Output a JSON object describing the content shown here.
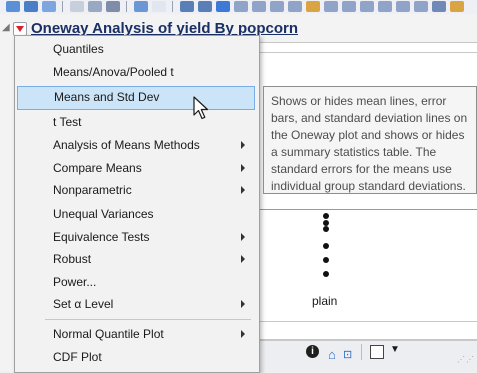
{
  "report": {
    "title": "Oneway Analysis of yield By popcorn",
    "category_label": "plain"
  },
  "menu": {
    "items": [
      {
        "label": "Quantiles",
        "submenu": false
      },
      {
        "label": "Means/Anova/Pooled t",
        "submenu": false
      },
      {
        "label": "Means and Std Dev",
        "submenu": false,
        "highlighted": true
      },
      {
        "label": "t Test",
        "submenu": false
      },
      {
        "label": "Analysis of Means Methods",
        "submenu": true
      },
      {
        "label": "Compare Means",
        "submenu": true
      },
      {
        "label": "Nonparametric",
        "submenu": true
      },
      {
        "label": "Unequal Variances",
        "submenu": false
      },
      {
        "label": "Equivalence Tests",
        "submenu": true
      },
      {
        "label": "Robust",
        "submenu": true
      },
      {
        "label": "Power...",
        "submenu": false
      },
      {
        "label": "Set α Level",
        "submenu": true
      },
      {
        "label": "Normal Quantile Plot",
        "submenu": true
      },
      {
        "label": "CDF Plot",
        "submenu": false
      }
    ]
  },
  "tooltip": {
    "text": "Shows or hides mean lines, error bars, and standard deviation lines on the Oneway plot and shows or hides a summary statistics table. The standard errors for the means use individual group standard deviations."
  },
  "status": {
    "info_icon": "info-icon",
    "home_icon": "home-icon",
    "export_icon": "export-icon",
    "checkbox_icon": "checkbox-icon",
    "caret": "▼"
  },
  "colors": {
    "title": "#1a2f66",
    "red_triangle": "#d6202b",
    "menu_highlight": "#cce4f7"
  }
}
